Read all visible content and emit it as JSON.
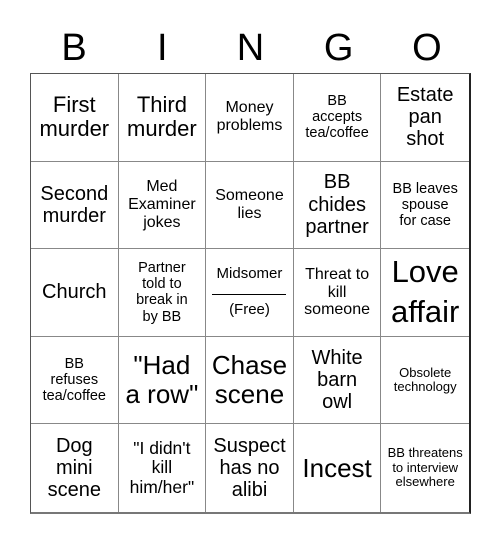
{
  "header": {
    "letters": [
      "B",
      "I",
      "N",
      "G",
      "O"
    ]
  },
  "board": {
    "rows": [
      [
        "First\nmurder",
        "Third\nmurder",
        "Money\nproblems",
        "BB\naccepts\ntea/coffee",
        "Estate\npan\nshot"
      ],
      [
        "Second\nmurder",
        "Med\nExaminer\njokes",
        "Someone\nlies",
        "BB\nchides\npartner",
        "BB leaves\nspouse\nfor case"
      ],
      [
        "Church",
        "Partner\ntold to\nbreak in\nby BB",
        "FREE",
        "Threat to\nkill\nsomeone",
        "Love\naffair"
      ],
      [
        "BB\nrefuses\ntea/coffee",
        "\"Had\na row\"",
        "Chase\nscene",
        "White\nbarn\nowl",
        "Obsolete\ntechnology"
      ],
      [
        "Dog\nmini\nscene",
        "\"I didn't\nkill\nhim/her\"",
        "Suspect\nhas no\nalibi",
        "Incest",
        "BB threatens\nto interview\nelsewhere"
      ]
    ],
    "free_space": {
      "title": "Midsomer",
      "label": "(Free)"
    }
  }
}
